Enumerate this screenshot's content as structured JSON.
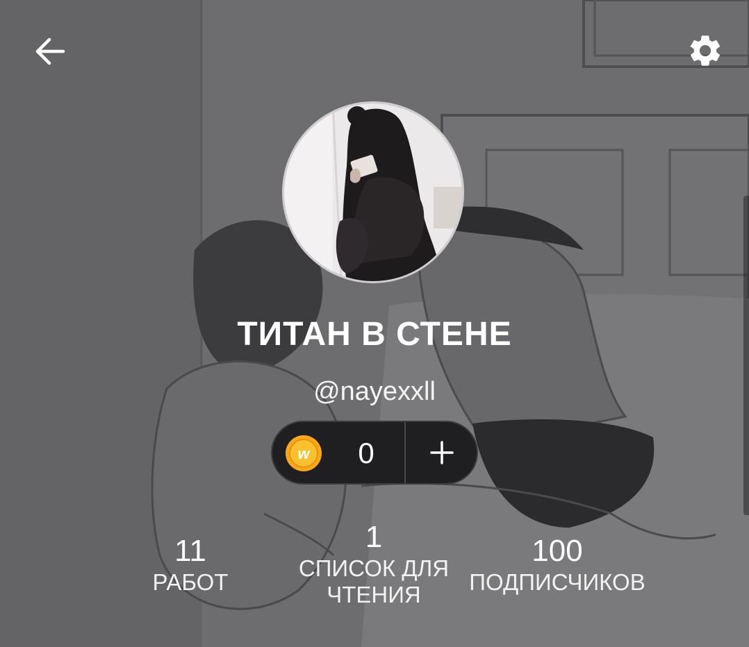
{
  "header": {
    "back_icon": "arrow-left-icon",
    "settings_icon": "gear-icon"
  },
  "profile": {
    "display_name": "ТИТАН В СТЕНЕ",
    "username": "@nayexxll"
  },
  "coins": {
    "icon": "wattpad-coin-icon",
    "count": "0",
    "add_icon": "plus-icon",
    "coin_color": "#f7a91a"
  },
  "stats": {
    "works": {
      "value": "11",
      "label": "РАБОТ"
    },
    "reading_lists": {
      "value": "1",
      "label_line1": "СПИСОК ДЛЯ",
      "label_line2": "ЧТЕНИЯ"
    },
    "followers": {
      "value": "100",
      "label": "ПОДПИСЧИКОВ"
    }
  }
}
